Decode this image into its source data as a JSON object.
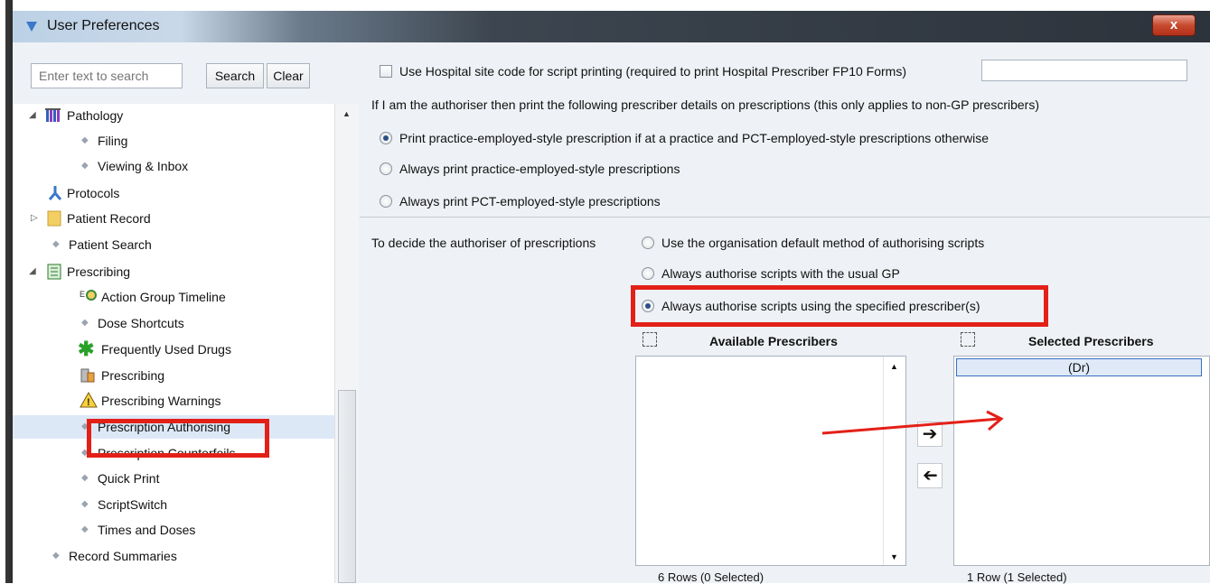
{
  "window": {
    "title": "User Preferences",
    "close_label": "x"
  },
  "search": {
    "placeholder": "Enter text to search",
    "search_label": "Search",
    "clear_label": "Clear"
  },
  "tree": {
    "items": [
      {
        "label": "Pathology"
      },
      {
        "label": "Filing"
      },
      {
        "label": "Viewing & Inbox"
      },
      {
        "label": "Protocols"
      },
      {
        "label": "Patient Record"
      },
      {
        "label": "Patient Search"
      },
      {
        "label": "Prescribing"
      },
      {
        "label": "Action Group Timeline"
      },
      {
        "label": "Dose Shortcuts"
      },
      {
        "label": "Frequently Used Drugs"
      },
      {
        "label": "Prescribing"
      },
      {
        "label": "Prescribing Warnings"
      },
      {
        "label": "Prescription Authorising"
      },
      {
        "label": "Prescription Counterfoils"
      },
      {
        "label": "Quick Print"
      },
      {
        "label": "ScriptSwitch"
      },
      {
        "label": "Times and Doses"
      },
      {
        "label": "Record Summaries"
      }
    ]
  },
  "settings": {
    "hospital_code_label": "Use Hospital site code for script printing (required to print Hospital Prescriber FP10 Forms)",
    "authoriser_print_label": "If I am the authoriser then print the following prescriber details on prescriptions (this only applies to non-GP prescribers)",
    "print_options": [
      "Print practice-employed-style prescription if at a practice and PCT-employed-style prescriptions otherwise",
      "Always print practice-employed-style prescriptions",
      "Always print PCT-employed-style prescriptions"
    ],
    "decide_label": "To decide the authoriser of prescriptions",
    "authorise_options": [
      "Use the organisation default method of authorising scripts",
      "Always authorise scripts with the usual GP",
      "Always authorise scripts using the specified prescriber(s)"
    ]
  },
  "prescribers": {
    "available_header": "Available Prescribers",
    "selected_header": "Selected Prescribers",
    "selected_rows": [
      "(Dr)"
    ],
    "available_footer": "6 Rows (0 Selected)",
    "selected_footer": "1 Row (1 Selected)",
    "add_icon": "arrow-right-icon",
    "remove_icon": "arrow-left-icon"
  },
  "colors": {
    "highlight_red": "#e32018",
    "radio_selected": "#2a4f86"
  }
}
